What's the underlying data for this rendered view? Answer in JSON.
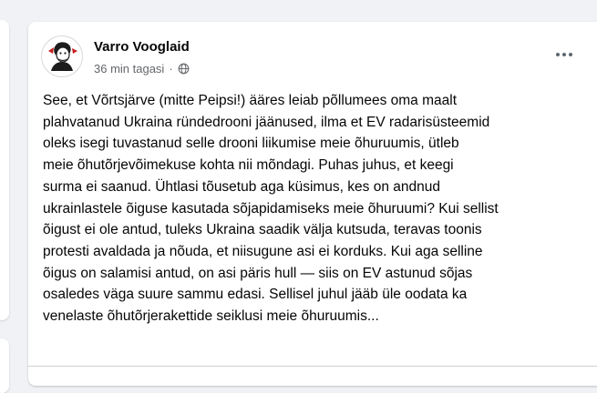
{
  "post": {
    "author": "Varro Vooglaid",
    "time": "36 min tagasi",
    "separator": "·",
    "privacy_icon": "globe-icon",
    "more_icon": "more-horizontal-icon",
    "text": "See, et Võrtsjärve (mitte Peipsi!) ääres leiab põllumees oma maalt\nplahvatanud Ukraina ründedrooni jäänused, ilma et EV radarisüsteemid\noleks isegi tuvastanud selle drooni liikumise meie õhuruumis, ütleb\nmeie õhutõrjevõimekuse kohta nii mõndagi. Puhas juhus, et keegi\nsurma ei saanud. Ühtlasi tõusetub aga küsimus, kes on andnud\nukrainlastele õiguse kasutada sõjapidamiseks meie õhuruumi? Kui sellist\nõigust ei ole antud, tuleks Ukraina saadik välja kutsuda, teravas toonis\nprotesti avaldada ja nõuda, et niisugune asi ei korduks. Kui aga selline\nõigus on salamisi antud, on asi päris hull — siis on EV astunud sõjas\nosaledes väga suure sammu edasi. Sellisel juhul jääb üle oodata ka\nvenelaste õhutõrjerakettide seiklusi meie õhuruumis..."
  },
  "colors": {
    "background": "#f0f2f5",
    "card": "#ffffff",
    "text": "#050505",
    "secondary_text": "#65676b"
  }
}
